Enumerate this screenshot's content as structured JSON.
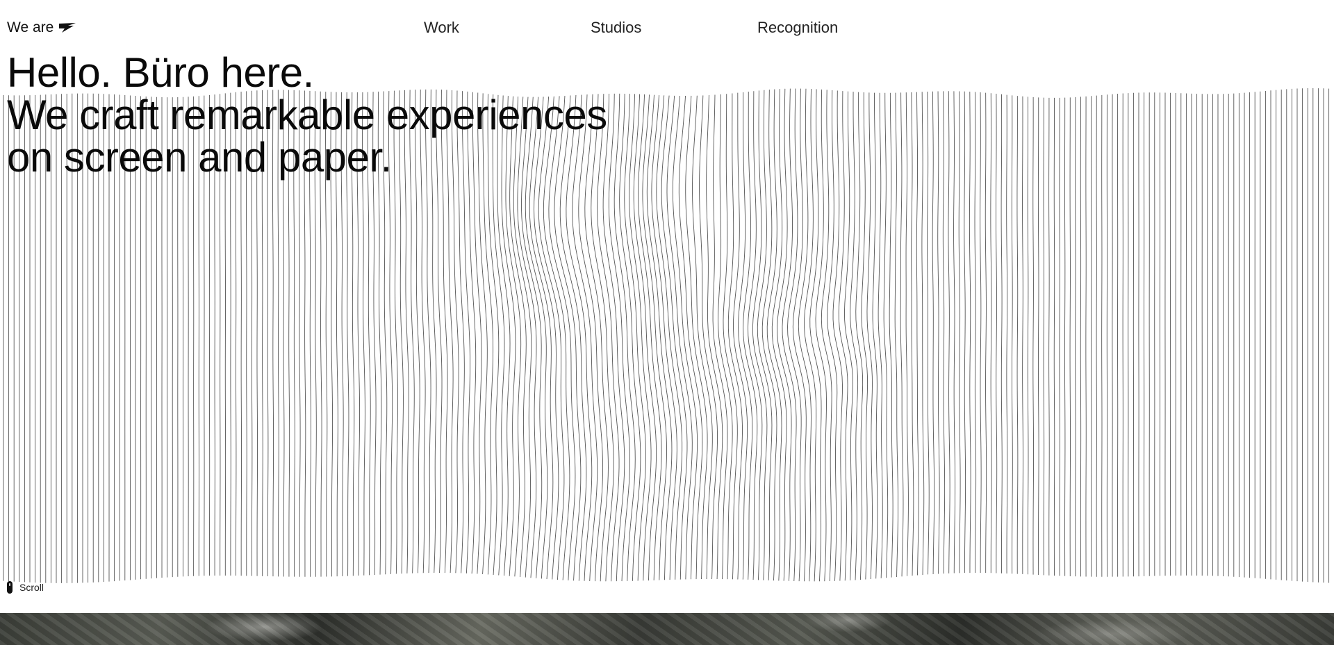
{
  "nav": {
    "brand_label": "We are",
    "brand_icon": "pennant-logo-icon",
    "links": [
      "Work",
      "Studios",
      "Recognition"
    ]
  },
  "hero": {
    "line1": "Hello. Büro here.",
    "line2": "We craft remarkable experiences",
    "line3": "on screen and paper."
  },
  "scroll": {
    "label": "Scroll",
    "icon": "mouse-icon"
  },
  "colors": {
    "background": "#ffffff",
    "text": "#111111",
    "lines": "#555555"
  }
}
